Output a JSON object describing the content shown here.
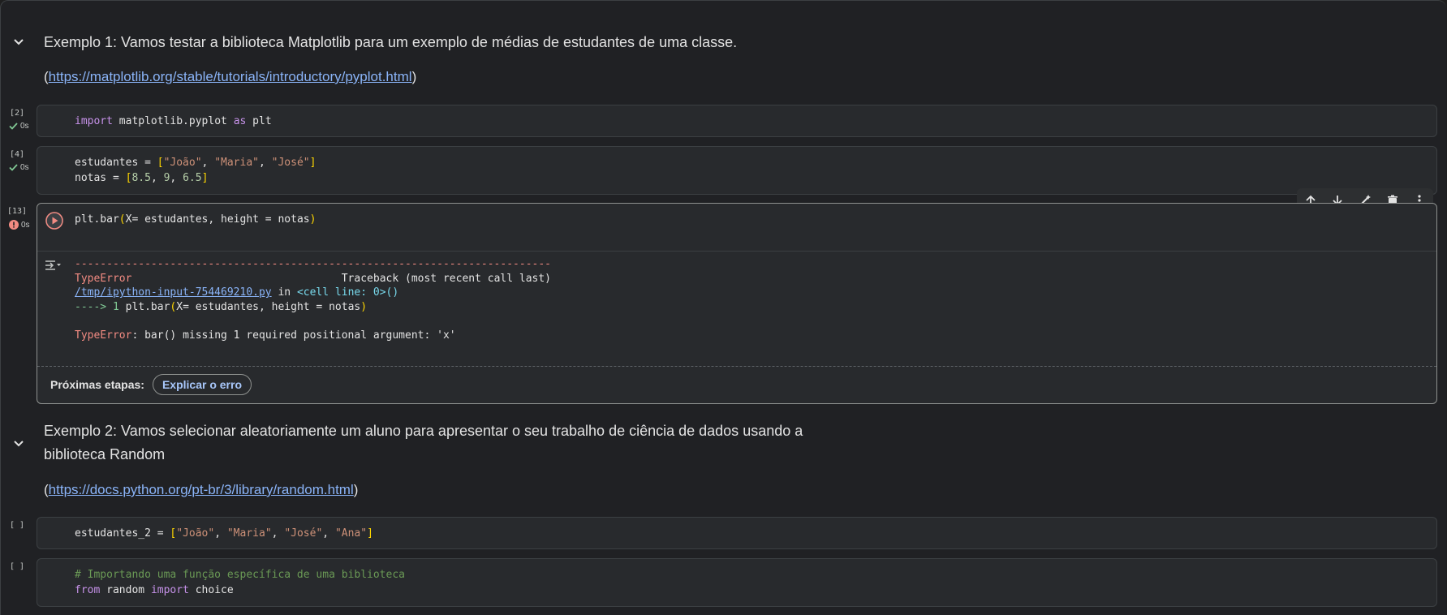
{
  "section1": {
    "heading": "Exemplo 1: Vamos testar a biblioteca Matplotlib para um exemplo de médias de estudantes de uma classe.",
    "link_open": "(",
    "link": "https://matplotlib.org/stable/tutorials/introductory/pyplot.html",
    "link_close": ")"
  },
  "cell1": {
    "exec_count": "[2]",
    "time": "0s",
    "code": {
      "kw1": "import",
      "mod": " matplotlib.pyplot ",
      "kw2": "as",
      "alias": " plt"
    }
  },
  "cell2": {
    "exec_count": "[4]",
    "time": "0s",
    "line1": {
      "a": "estudantes = ",
      "ob": "[",
      "s1": "\"João\"",
      "c1": ", ",
      "s2": "\"Maria\"",
      "c2": ", ",
      "s3": "\"José\"",
      "cb": "]"
    },
    "line2": {
      "a": "notas = ",
      "ob": "[",
      "n1": "8.5",
      "c1": ", ",
      "n2": "9",
      "c2": ", ",
      "n3": "6.5",
      "cb": "]"
    }
  },
  "cell3": {
    "exec_count": "[13]",
    "time": "0s",
    "code": {
      "a": "plt.bar",
      "op": "(",
      "b": "X= estudantes, height = notas",
      "cp": ")"
    },
    "output": {
      "dashes": "---------------------------------------------------------------------------",
      "err_name": "TypeError",
      "traceback_label": "                                 Traceback (most recent call last)",
      "file_link": "/tmp/ipython-input-754469210.py",
      "in_text": " in ",
      "cell_line": "<cell line: 0>()",
      "arrow": "----> 1 ",
      "arrow_code_a": "plt.bar",
      "arrow_code_op": "(",
      "arrow_code_b": "X= estudantes, height = notas",
      "arrow_code_cp": ")",
      "final_err": "TypeError",
      "final_msg": ": bar() missing 1 required positional argument: 'x'"
    },
    "next_steps_label": "Próximas etapas:",
    "explain_button": "Explicar o erro"
  },
  "section2": {
    "heading_line1": "Exemplo 2: Vamos selecionar aleatoriamente um aluno para apresentar o seu trabalho de ciência de dados usando a",
    "heading_line2": "biblioteca Random",
    "link_open": "(",
    "link": "https://docs.python.org/pt-br/3/library/random.html",
    "link_close": ")"
  },
  "cell4": {
    "exec_count": "[ ]",
    "code": {
      "a": "estudantes_2 = ",
      "ob": "[",
      "s1": "\"João\"",
      "c1": ", ",
      "s2": "\"Maria\"",
      "c2": ", ",
      "s3": "\"José\"",
      "c3": ", ",
      "s4": "\"Ana\"",
      "cb": "]"
    }
  },
  "cell5": {
    "exec_count": "[ ]",
    "comment": "# Importando uma função específica de uma biblioteca",
    "line2": {
      "kw1": "from",
      "mod": " random ",
      "kw2": "import",
      "name": " choice"
    }
  },
  "icons": [
    "chevron-down-icon",
    "check-icon",
    "error-icon",
    "run-icon",
    "arrow-up-icon",
    "arrow-down-icon",
    "edit-icon",
    "delete-icon",
    "more-icon",
    "output-toggle-icon"
  ],
  "colors": {
    "background": "#202124",
    "cell": "#282a2d",
    "link": "#8ab4f8",
    "error": "#f28b82",
    "success": "#81c995"
  }
}
